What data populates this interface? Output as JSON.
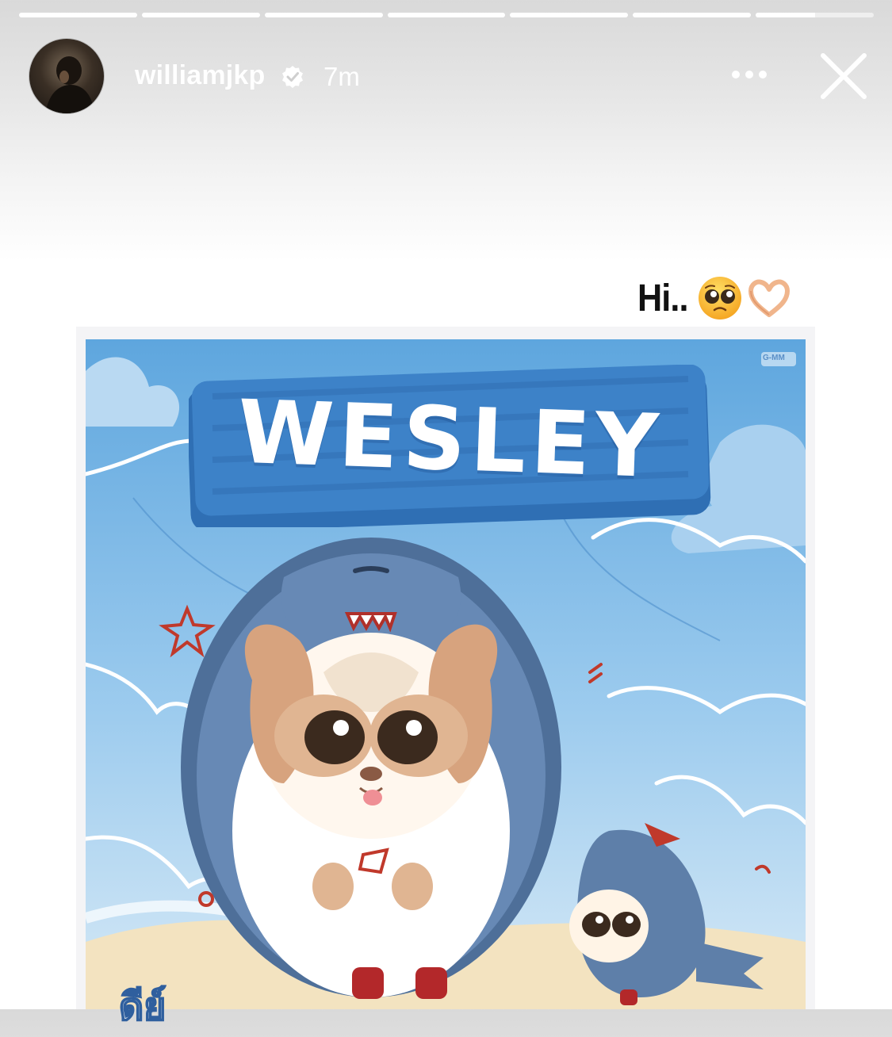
{
  "story": {
    "segments": [
      1,
      1,
      1,
      1,
      1,
      1,
      0.5
    ],
    "username": "williamjkp",
    "time": "7m",
    "caption": "Hi.."
  },
  "icons": {
    "verified": "verified-badge-icon",
    "more": "more-options-icon",
    "close": "close-icon",
    "emoji_1": "pleading-face-emoji",
    "emoji_2": "heart-hands-emoji"
  },
  "poster": {
    "title": "WESLEY",
    "logo": "G-MM",
    "bottom_text": "ดีย์"
  },
  "colors": {
    "sky": "#6aaee0",
    "board": "#3d82c8",
    "shark": "#5a7ea8",
    "accent_red": "#c0392b"
  }
}
